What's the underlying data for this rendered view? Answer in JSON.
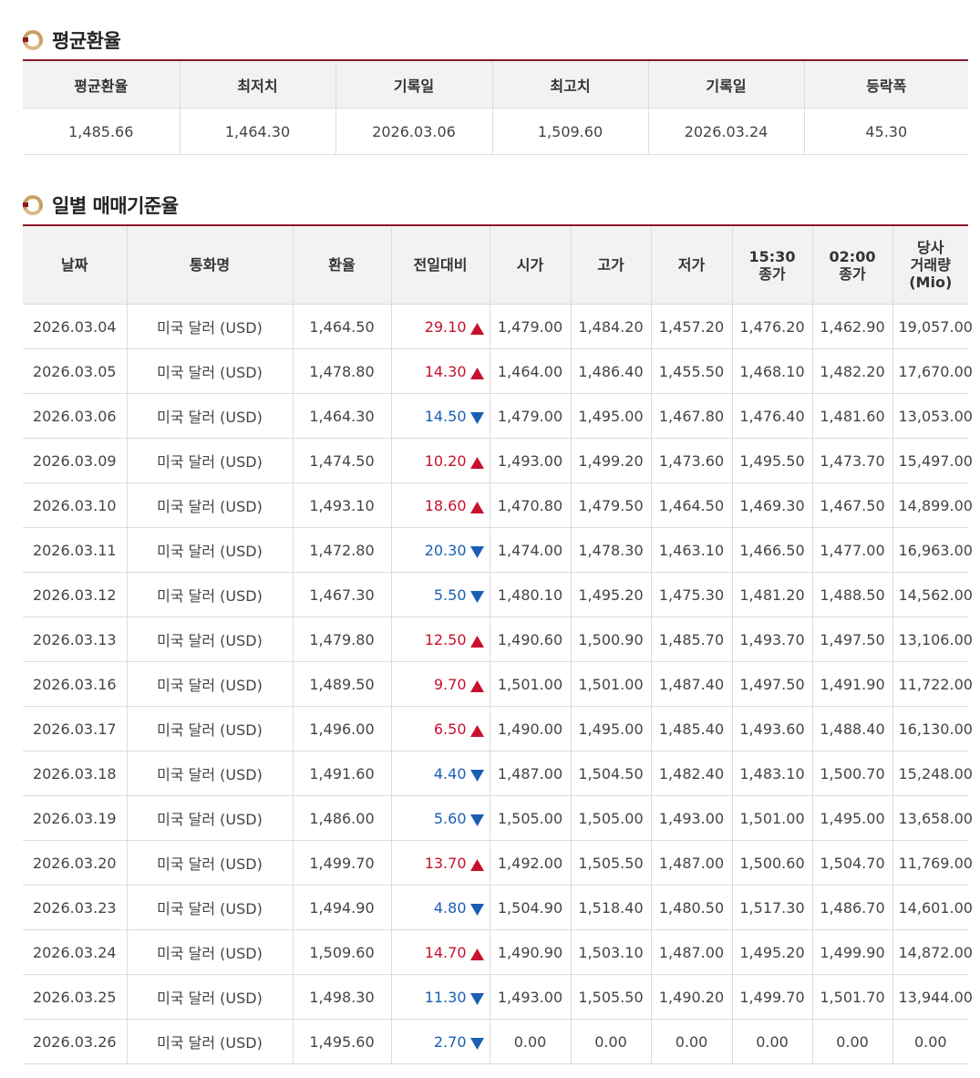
{
  "summary": {
    "title": "평균환율",
    "headers": [
      "평균환율",
      "최저치",
      "기록일",
      "최고치",
      "기록일",
      "등락폭"
    ],
    "values": [
      "1,485.66",
      "1,464.30",
      "2026.03.06",
      "1,509.60",
      "2026.03.24",
      "45.30"
    ]
  },
  "daily": {
    "title": "일별 매매기준율",
    "headers": {
      "date": "날짜",
      "currency": "통화명",
      "rate": "환율",
      "change": "전일대비",
      "open": "시가",
      "high": "고가",
      "low": "저가",
      "close1530": [
        "15:30",
        "종가"
      ],
      "close0200": [
        "02:00",
        "종가"
      ],
      "volume": [
        "당사",
        "거래량",
        "(Mio)"
      ]
    },
    "rows": [
      {
        "date": "2026.03.04",
        "currency": "미국 달러 (USD)",
        "rate": "1,464.50",
        "change": "29.10",
        "dir": "up",
        "open": "1,479.00",
        "high": "1,484.20",
        "low": "1,457.20",
        "c1530": "1,476.20",
        "c0200": "1,462.90",
        "vol": "19,057.00"
      },
      {
        "date": "2026.03.05",
        "currency": "미국 달러 (USD)",
        "rate": "1,478.80",
        "change": "14.30",
        "dir": "up",
        "open": "1,464.00",
        "high": "1,486.40",
        "low": "1,455.50",
        "c1530": "1,468.10",
        "c0200": "1,482.20",
        "vol": "17,670.00"
      },
      {
        "date": "2026.03.06",
        "currency": "미국 달러 (USD)",
        "rate": "1,464.30",
        "change": "14.50",
        "dir": "down",
        "open": "1,479.00",
        "high": "1,495.00",
        "low": "1,467.80",
        "c1530": "1,476.40",
        "c0200": "1,481.60",
        "vol": "13,053.00"
      },
      {
        "date": "2026.03.09",
        "currency": "미국 달러 (USD)",
        "rate": "1,474.50",
        "change": "10.20",
        "dir": "up",
        "open": "1,493.00",
        "high": "1,499.20",
        "low": "1,473.60",
        "c1530": "1,495.50",
        "c0200": "1,473.70",
        "vol": "15,497.00"
      },
      {
        "date": "2026.03.10",
        "currency": "미국 달러 (USD)",
        "rate": "1,493.10",
        "change": "18.60",
        "dir": "up",
        "open": "1,470.80",
        "high": "1,479.50",
        "low": "1,464.50",
        "c1530": "1,469.30",
        "c0200": "1,467.50",
        "vol": "14,899.00"
      },
      {
        "date": "2026.03.11",
        "currency": "미국 달러 (USD)",
        "rate": "1,472.80",
        "change": "20.30",
        "dir": "down",
        "open": "1,474.00",
        "high": "1,478.30",
        "low": "1,463.10",
        "c1530": "1,466.50",
        "c0200": "1,477.00",
        "vol": "16,963.00"
      },
      {
        "date": "2026.03.12",
        "currency": "미국 달러 (USD)",
        "rate": "1,467.30",
        "change": "5.50",
        "dir": "down",
        "open": "1,480.10",
        "high": "1,495.20",
        "low": "1,475.30",
        "c1530": "1,481.20",
        "c0200": "1,488.50",
        "vol": "14,562.00"
      },
      {
        "date": "2026.03.13",
        "currency": "미국 달러 (USD)",
        "rate": "1,479.80",
        "change": "12.50",
        "dir": "up",
        "open": "1,490.60",
        "high": "1,500.90",
        "low": "1,485.70",
        "c1530": "1,493.70",
        "c0200": "1,497.50",
        "vol": "13,106.00"
      },
      {
        "date": "2026.03.16",
        "currency": "미국 달러 (USD)",
        "rate": "1,489.50",
        "change": "9.70",
        "dir": "up",
        "open": "1,501.00",
        "high": "1,501.00",
        "low": "1,487.40",
        "c1530": "1,497.50",
        "c0200": "1,491.90",
        "vol": "11,722.00"
      },
      {
        "date": "2026.03.17",
        "currency": "미국 달러 (USD)",
        "rate": "1,496.00",
        "change": "6.50",
        "dir": "up",
        "open": "1,490.00",
        "high": "1,495.00",
        "low": "1,485.40",
        "c1530": "1,493.60",
        "c0200": "1,488.40",
        "vol": "16,130.00"
      },
      {
        "date": "2026.03.18",
        "currency": "미국 달러 (USD)",
        "rate": "1,491.60",
        "change": "4.40",
        "dir": "down",
        "open": "1,487.00",
        "high": "1,504.50",
        "low": "1,482.40",
        "c1530": "1,483.10",
        "c0200": "1,500.70",
        "vol": "15,248.00"
      },
      {
        "date": "2026.03.19",
        "currency": "미국 달러 (USD)",
        "rate": "1,486.00",
        "change": "5.60",
        "dir": "down",
        "open": "1,505.00",
        "high": "1,505.00",
        "low": "1,493.00",
        "c1530": "1,501.00",
        "c0200": "1,495.00",
        "vol": "13,658.00"
      },
      {
        "date": "2026.03.20",
        "currency": "미국 달러 (USD)",
        "rate": "1,499.70",
        "change": "13.70",
        "dir": "up",
        "open": "1,492.00",
        "high": "1,505.50",
        "low": "1,487.00",
        "c1530": "1,500.60",
        "c0200": "1,504.70",
        "vol": "11,769.00"
      },
      {
        "date": "2026.03.23",
        "currency": "미국 달러 (USD)",
        "rate": "1,494.90",
        "change": "4.80",
        "dir": "down",
        "open": "1,504.90",
        "high": "1,518.40",
        "low": "1,480.50",
        "c1530": "1,517.30",
        "c0200": "1,486.70",
        "vol": "14,601.00"
      },
      {
        "date": "2026.03.24",
        "currency": "미국 달러 (USD)",
        "rate": "1,509.60",
        "change": "14.70",
        "dir": "up",
        "open": "1,490.90",
        "high": "1,503.10",
        "low": "1,487.00",
        "c1530": "1,495.20",
        "c0200": "1,499.90",
        "vol": "14,872.00"
      },
      {
        "date": "2026.03.25",
        "currency": "미국 달러 (USD)",
        "rate": "1,498.30",
        "change": "11.30",
        "dir": "down",
        "open": "1,493.00",
        "high": "1,505.50",
        "low": "1,490.20",
        "c1530": "1,499.70",
        "c0200": "1,501.70",
        "vol": "13,944.00"
      },
      {
        "date": "2026.03.26",
        "currency": "미국 달러 (USD)",
        "rate": "1,495.60",
        "change": "2.70",
        "dir": "down",
        "open": "0.00",
        "high": "0.00",
        "low": "0.00",
        "c1530": "0.00",
        "c0200": "0.00",
        "vol": "0.00"
      }
    ]
  },
  "colors": {
    "accent": "#8b1a2b",
    "up": "#c8102e",
    "down": "#1a5fb4",
    "header_bg": "#f2f2f2",
    "icon_gold": "#c9a063"
  },
  "icons": {
    "section": "ring-bullet-icon",
    "up": "triangle-up-icon",
    "down": "triangle-down-icon"
  }
}
